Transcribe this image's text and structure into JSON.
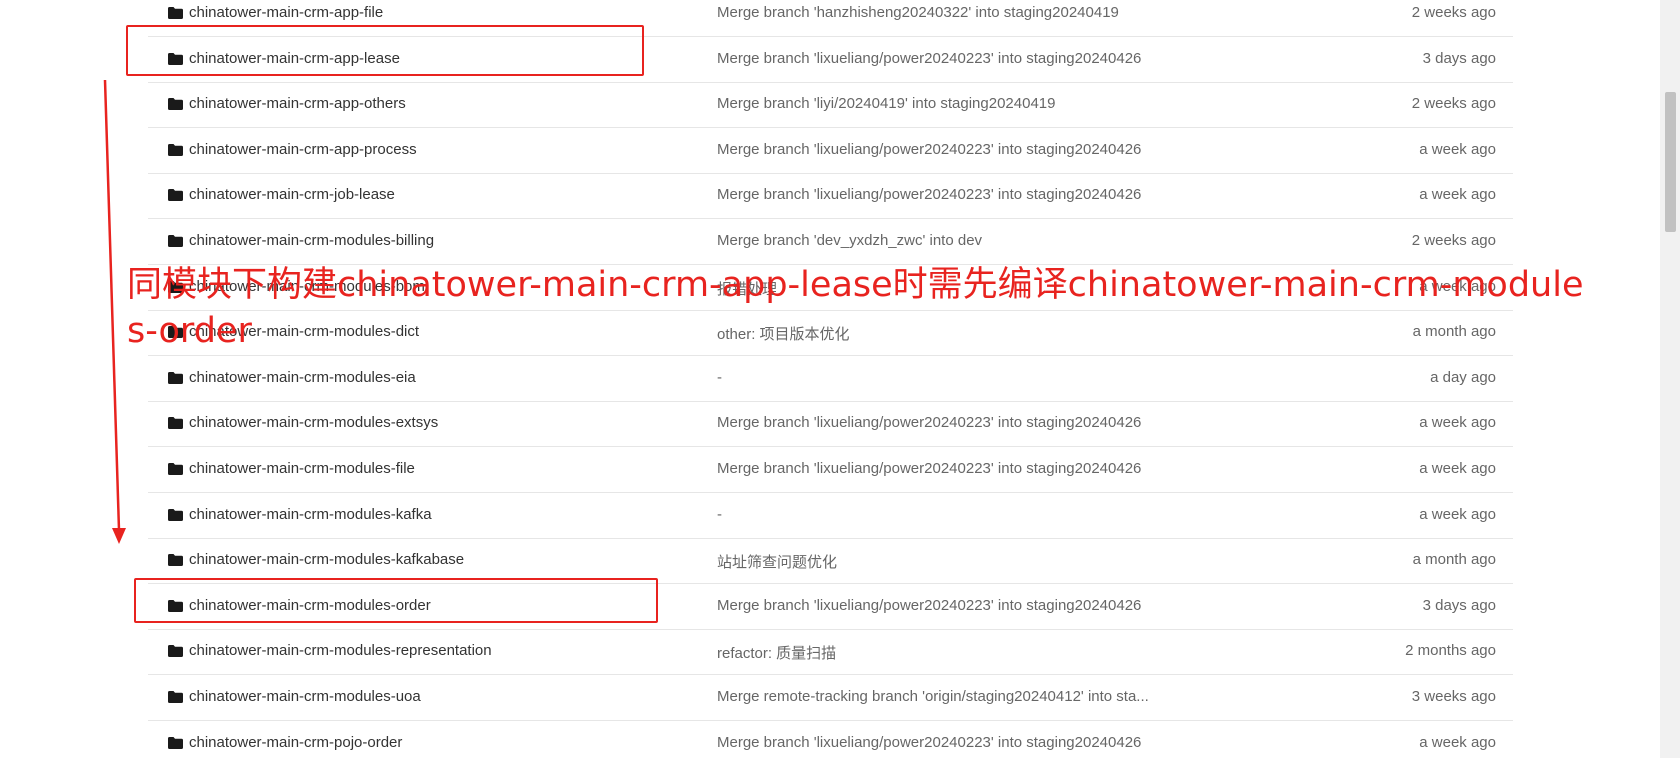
{
  "file_list": {
    "rows": [
      {
        "name": "chinatower-main-crm-app-file",
        "message": "Merge branch 'hanzhisheng20240322' into staging20240419",
        "age": "2 weeks ago"
      },
      {
        "name": "chinatower-main-crm-app-lease",
        "message": "Merge branch 'lixueliang/power20240223' into staging20240426",
        "age": "3 days ago"
      },
      {
        "name": "chinatower-main-crm-app-others",
        "message": "Merge branch 'liyi/20240419' into staging20240419",
        "age": "2 weeks ago"
      },
      {
        "name": "chinatower-main-crm-app-process",
        "message": "Merge branch 'lixueliang/power20240223' into staging20240426",
        "age": "a week ago"
      },
      {
        "name": "chinatower-main-crm-job-lease",
        "message": "Merge branch 'lixueliang/power20240223' into staging20240426",
        "age": "a week ago"
      },
      {
        "name": "chinatower-main-crm-modules-billing",
        "message": "Merge branch 'dev_yxdzh_zwc' into dev",
        "age": "2 weeks ago"
      },
      {
        "name": "chinatower-main-crm-modules-bom",
        "message": "报错处理",
        "age": "a week ago"
      },
      {
        "name": "chinatower-main-crm-modules-dict",
        "message": "other: 项目版本优化",
        "age": "a month ago"
      },
      {
        "name": "chinatower-main-crm-modules-eia",
        "message": "-",
        "age": "a day ago"
      },
      {
        "name": "chinatower-main-crm-modules-extsys",
        "message": "Merge branch 'lixueliang/power20240223' into staging20240426",
        "age": "a week ago"
      },
      {
        "name": "chinatower-main-crm-modules-file",
        "message": "Merge branch 'lixueliang/power20240223' into staging20240426",
        "age": "a week ago"
      },
      {
        "name": "chinatower-main-crm-modules-kafka",
        "message": "-",
        "age": "a week ago"
      },
      {
        "name": "chinatower-main-crm-modules-kafkabase",
        "message": "站址筛查问题优化",
        "age": "a month ago"
      },
      {
        "name": "chinatower-main-crm-modules-order",
        "message": "Merge branch 'lixueliang/power20240223' into staging20240426",
        "age": "3 days ago"
      },
      {
        "name": "chinatower-main-crm-modules-representation",
        "message": "refactor: 质量扫描",
        "age": "2 months ago"
      },
      {
        "name": "chinatower-main-crm-modules-uoa",
        "message": "Merge remote-tracking branch 'origin/staging20240412' into sta...",
        "age": "3 weeks ago"
      },
      {
        "name": "chinatower-main-crm-pojo-order",
        "message": "Merge branch 'lixueliang/power20240223' into staging20240426",
        "age": "a week ago"
      }
    ]
  },
  "annotation": {
    "text": "同模块下构建chinatower-main-crm-app-lease时需先编译chinatower-main-crm-modules-order",
    "color": "#e8231f"
  },
  "icons": {
    "folder": "folder-icon"
  },
  "colors": {
    "name_text": "#333333",
    "meta_text": "#666666",
    "row_border": "#e6e6e6",
    "annotation_red": "#e8231f"
  }
}
